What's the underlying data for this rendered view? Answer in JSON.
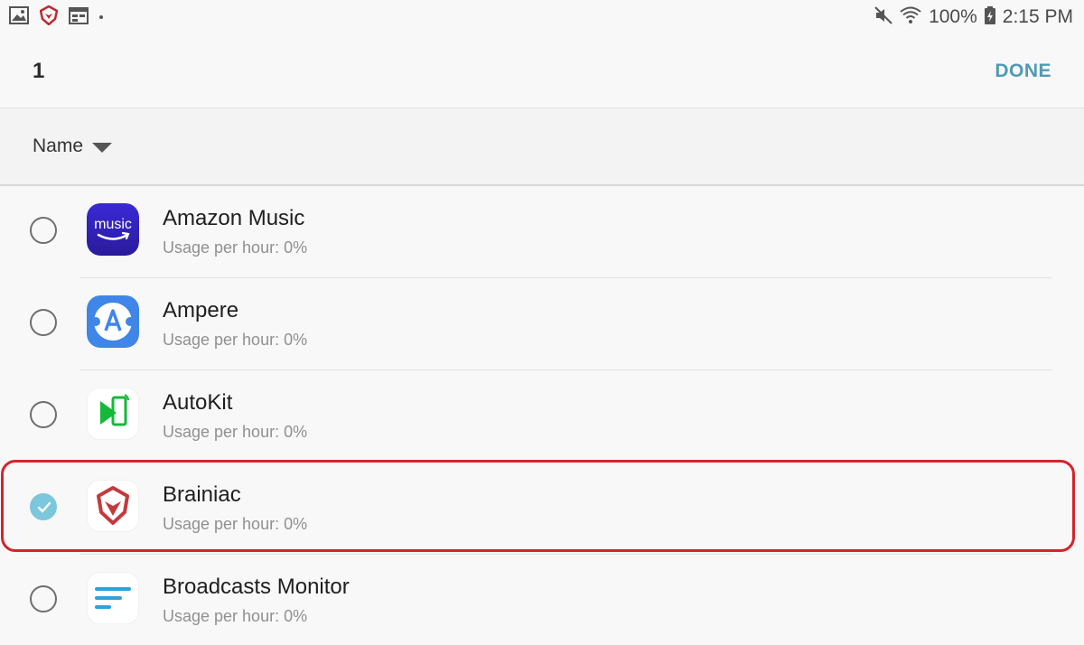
{
  "status_bar": {
    "battery_percent": "100%",
    "time": "2:15 PM",
    "icons": [
      "image-icon",
      "brainiac-notification-icon",
      "calendar-icon",
      "dot-icon",
      "mute-icon",
      "wifi-icon",
      "battery-charging-icon"
    ]
  },
  "header": {
    "selected_count": "1",
    "done_label": "DONE"
  },
  "sort": {
    "label": "Name"
  },
  "apps": [
    {
      "name": "Amazon Music",
      "usage": "Usage per hour: 0%",
      "checked": false,
      "icon": "amazon-music-icon"
    },
    {
      "name": "Ampere",
      "usage": "Usage per hour: 0%",
      "checked": false,
      "icon": "ampere-icon"
    },
    {
      "name": "AutoKit",
      "usage": "Usage per hour: 0%",
      "checked": false,
      "icon": "autokit-icon"
    },
    {
      "name": "Brainiac",
      "usage": "Usage per hour: 0%",
      "checked": true,
      "icon": "brainiac-icon"
    },
    {
      "name": "Broadcasts Monitor",
      "usage": "Usage per hour: 0%",
      "checked": false,
      "icon": "broadcasts-monitor-icon"
    }
  ],
  "icon_labels": {
    "amazon_music": "music"
  },
  "colors": {
    "accent": "#4f9bb3",
    "checked_radio": "#7cc7dc",
    "highlight": "#d4242c"
  }
}
